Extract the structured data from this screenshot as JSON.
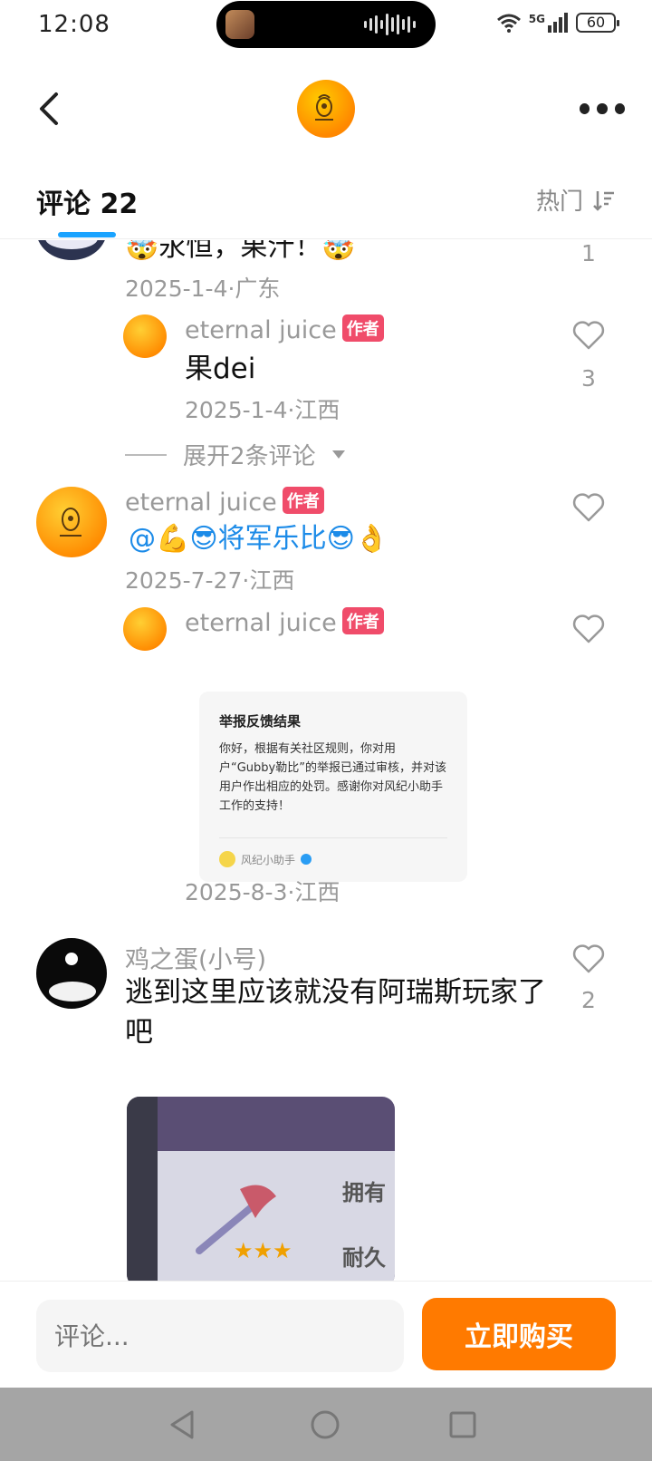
{
  "status_bar": {
    "time": "12:08",
    "network": "5G",
    "battery": "60"
  },
  "header": {
    "back_icon": "chevron-left-icon",
    "more_icon": "more-dots-icon"
  },
  "tabs": {
    "title": "评论 22",
    "sort_label": "热门"
  },
  "comments": [
    {
      "text": "🤯永恒，果汁！🤯",
      "meta": "2025-1-4·广东",
      "likes": "1",
      "replies": [
        {
          "name": "eternal juice",
          "badge": "作者",
          "text": "果dei",
          "meta": "2025-1-4·江西",
          "likes": "3"
        }
      ],
      "expand_label": "展开2条评论"
    },
    {
      "name": "eternal juice",
      "badge": "作者",
      "text_mention": "@💪😎将军乐比😎👌",
      "meta": "2025-7-27·江西",
      "replies": [
        {
          "name": "eternal juice",
          "badge": "作者",
          "meta": "2025-8-3·江西",
          "image": {
            "title": "举报反馈结果",
            "body": "你好，根据有关社区规则，你对用户“Gubby勒比”的举报已通过审核，并对该用户作出相应的处罚。感谢你对风纪小助手工作的支持！",
            "footer": "风纪小助手"
          }
        }
      ]
    },
    {
      "name": "鸡之蛋(小号)",
      "text": "逃到这里应该就没有阿瑞斯玩家了吧",
      "likes": "2",
      "image_labels": [
        "拥有",
        "耐久"
      ]
    }
  ],
  "bottom_bar": {
    "comment_placeholder": "评论...",
    "buy_label": "立即购买"
  },
  "colors": {
    "accent": "#ff7a00",
    "author_badge": "#f04c6a",
    "mention_blue": "#1c8be8",
    "tab_underline": "#1aa3ff"
  }
}
